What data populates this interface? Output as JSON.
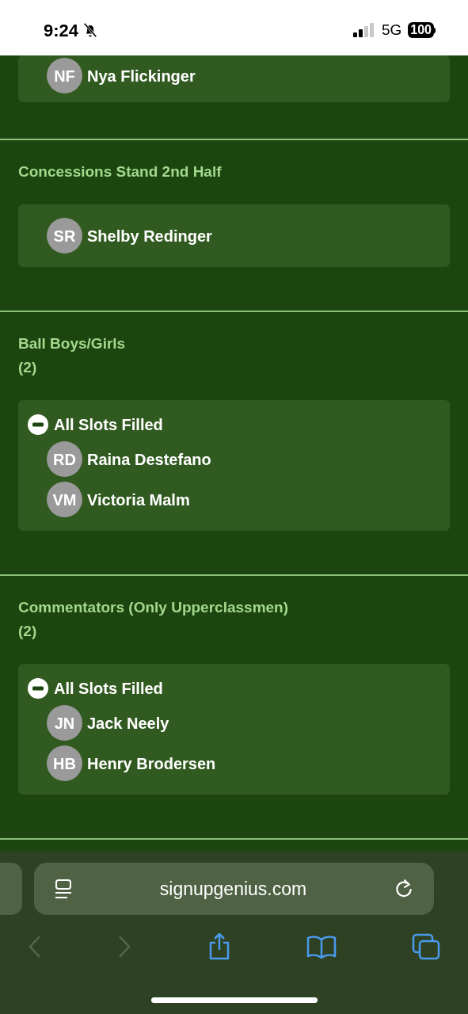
{
  "status_bar": {
    "time": "9:24",
    "network": "5G",
    "battery": "100"
  },
  "top_card": {
    "people": [
      {
        "initials": "NF",
        "name": "Nya Flickinger"
      }
    ]
  },
  "sections": [
    {
      "title": "Concessions Stand 2nd Half",
      "people": [
        {
          "initials": "SR",
          "name": "Shelby Redinger"
        }
      ]
    },
    {
      "title": "Ball Boys/Girls",
      "count": "(2)",
      "status": "All Slots Filled",
      "people": [
        {
          "initials": "RD",
          "name": "Raina Destefano"
        },
        {
          "initials": "VM",
          "name": "Victoria Malm"
        }
      ]
    },
    {
      "title": "Commentators (Only Upperclassmen)",
      "count": "(2)",
      "status": "All Slots Filled",
      "people": [
        {
          "initials": "JN",
          "name": "Jack Neely"
        },
        {
          "initials": "HB",
          "name": "Henry Brodersen"
        }
      ]
    }
  ],
  "browser": {
    "url": "signupgenius.com"
  }
}
